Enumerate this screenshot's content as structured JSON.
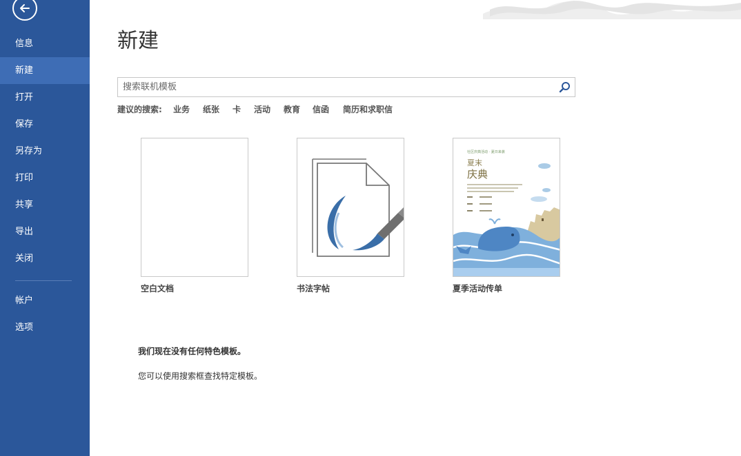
{
  "sidebar": {
    "back_icon": "back-arrow-icon",
    "items": [
      {
        "label": "信息"
      },
      {
        "label": "新建"
      },
      {
        "label": "打开"
      },
      {
        "label": "保存"
      },
      {
        "label": "另存为"
      },
      {
        "label": "打印"
      },
      {
        "label": "共享"
      },
      {
        "label": "导出"
      },
      {
        "label": "关闭"
      },
      {
        "label": "帐户"
      },
      {
        "label": "选项"
      }
    ],
    "active_label": "新建",
    "background": "#2b579a",
    "active_background": "#3e6db5"
  },
  "main": {
    "title": "新建",
    "search": {
      "placeholder": "搜索联机模板",
      "icon": "search-icon"
    },
    "suggested": {
      "label": "建议的搜索:",
      "links": [
        "业务",
        "纸张",
        "卡",
        "活动",
        "教育",
        "信函",
        "简历和求职信"
      ]
    },
    "templates": [
      {
        "label": "空白文档"
      },
      {
        "label": "书法字帖"
      },
      {
        "label": "夏季活动传单",
        "flyer_small_heading": "社区庆典活动 · 夏日来袭",
        "flyer_title_line1": "夏末",
        "flyer_title_line2": "庆典"
      }
    ],
    "no_featured_text": "我们现在没有任何特色模板。",
    "hint_text": "您可以使用搜索框查找特定模板。"
  }
}
